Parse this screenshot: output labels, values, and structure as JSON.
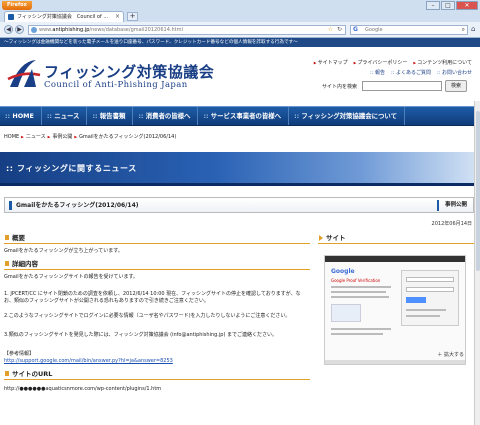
{
  "browser": {
    "menu_button": "Firefox",
    "tab_title": "フィッシング対策協議会　Council of ...",
    "new_tab": "+",
    "url_prefix": "www.",
    "url_domain": "antiphishing.jp",
    "url_path": "/news/database/gmail20120614.html",
    "search_placeholder": "Google",
    "search_engine_icon": "G"
  },
  "banner_text": "～フィッシングは金融機関などを装った電子メールを送り口座番号、パスワード、クレジットカード番号などの個人情報を詐取する行為です～",
  "header": {
    "logo_jp": "フィッシング対策協議会",
    "logo_en": "Council of Anti-Phishing Japan",
    "links": [
      "サイトマップ",
      "プライバシーポリシー",
      "コンテンツ利用について"
    ],
    "links2": [
      "報告",
      "よくあるご質問",
      "お問い合わせ"
    ],
    "search_label": "サイト内を検索",
    "search_button": "検索"
  },
  "gnav": [
    "HOME",
    "ニュース",
    "報告書類",
    "消費者の皆様へ",
    "サービス事業者の皆様へ",
    "フィッシング対策協議会について"
  ],
  "breadcrumb": [
    "HOME",
    "ニュース",
    "事例公開",
    "Gmailをかたるフィッシング(2012/06/14)"
  ],
  "section_title": ":: フィッシングに関するニュース",
  "article": {
    "title": "Gmailをかたるフィッシング(2012/06/14)",
    "category": "事例公開",
    "date": "2012年06月14日"
  },
  "content": {
    "summary_heading": "概要",
    "summary_text": "Gmailをかたるフィッシングが立ち上がっています。",
    "detail_heading": "詳細内容",
    "detail_p1": "Gmailをかたるフィッシングサイトの報告を受けています。",
    "detail_p2a": "1. JPCERT/CC にサイト閉鎖のための調査を依頼し、2012/6/14 10:00 現在、フィッシングサイトの停止を確認しておりますが、な",
    "detail_p2b": "お、類似のフィッシングサイトが公開される恐れもありますので引き続きご注意ください。",
    "detail_p3": "2.このようなフィッシングサイトでログインに必要な情報（ユーザ名やパスワード)を入力したりしないようにご注意ください。",
    "detail_p4": "3.類似のフィッシングサイトを発見した際には、フィッシング対策協議会 (info@antiphishing.jp) までご連絡ください。",
    "ref_heading": "【参考情報】",
    "ref_link": "http://support.google.com/mail/bin/answer.py?hl=ja&answer=8253",
    "url_heading": "サイトのURL",
    "phish_url": "http://●●●●●●aquaticsnmore.com/wp-content/plugins/1.htm"
  },
  "sidebar": {
    "heading": "サイト",
    "thumb_google": "Google",
    "thumb_text": "Google Proof Verification",
    "zoom_label": "＋ 拡大する"
  },
  "colors": {
    "nav_blue": "#1e5da8",
    "accent_orange": "#e2a02b",
    "logo_blue": "#1a3f86"
  }
}
